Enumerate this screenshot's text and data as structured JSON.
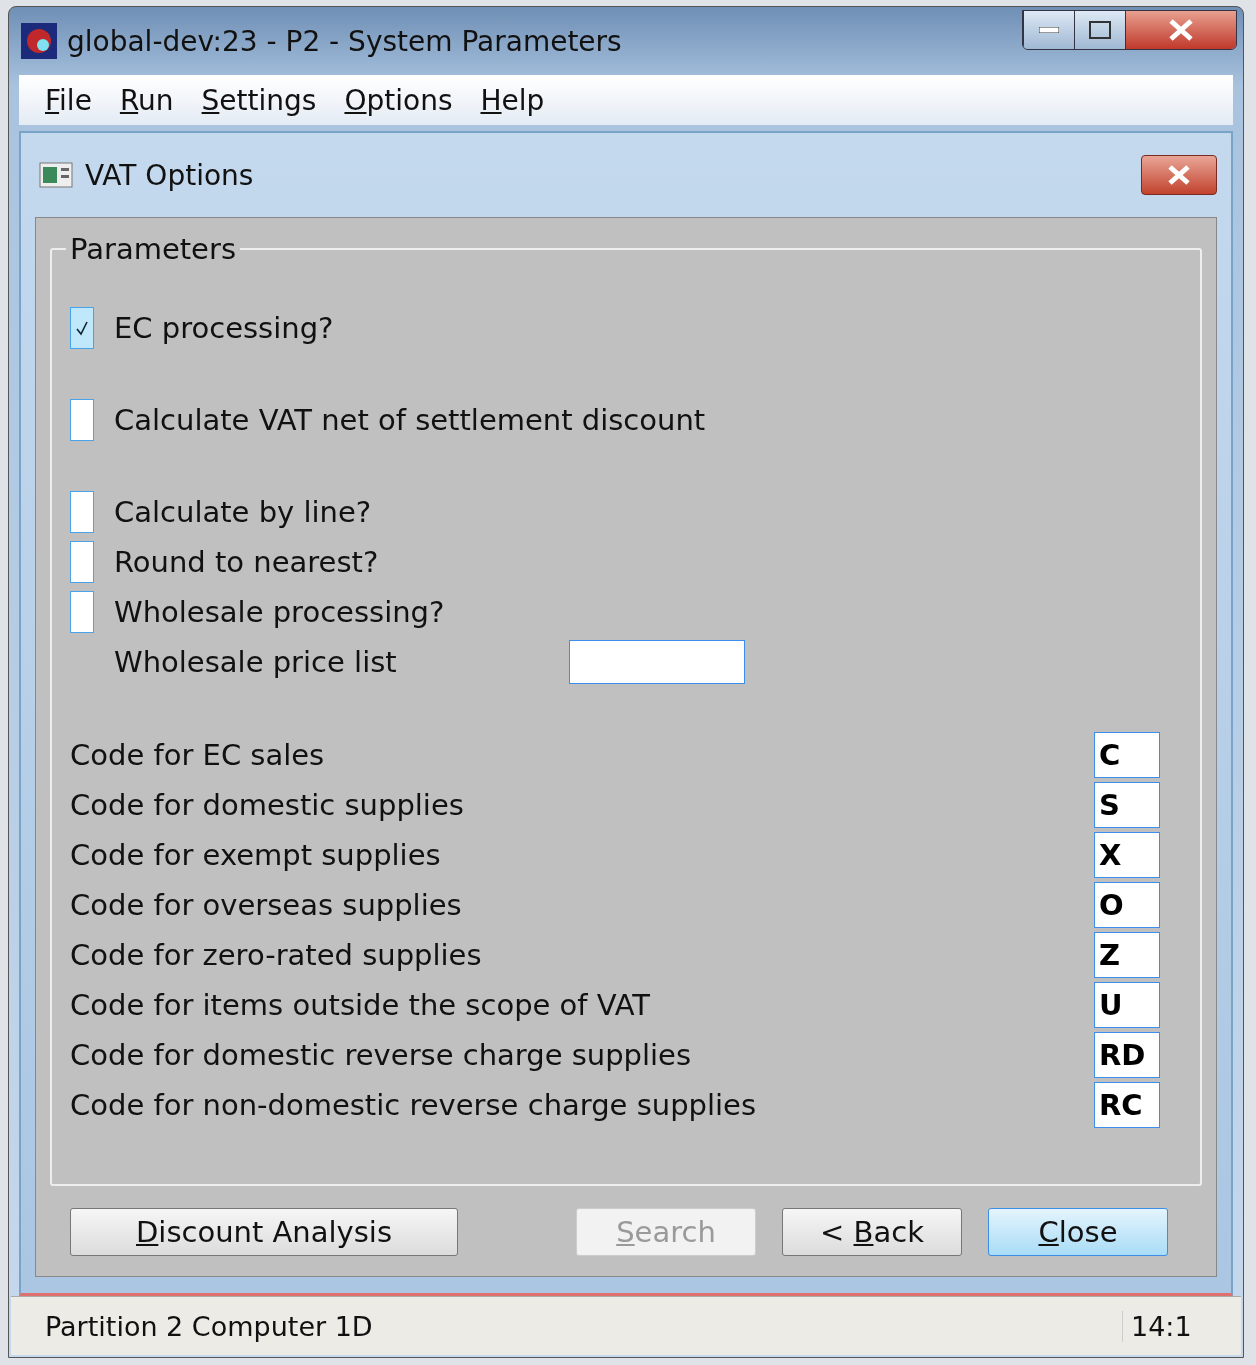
{
  "window": {
    "title": "global-dev:23 - P2 - System Parameters"
  },
  "menu": [
    {
      "key": "F",
      "rest": "ile"
    },
    {
      "key": "R",
      "rest": "un"
    },
    {
      "key": "S",
      "rest": "ettings"
    },
    {
      "key": "O",
      "rest": "ptions"
    },
    {
      "key": "H",
      "rest": "elp"
    }
  ],
  "dialog": {
    "title": "VAT Options",
    "parameters": {
      "legend": "Parameters",
      "groups": [
        [
          {
            "kind": "checkbox",
            "label": "EC processing?",
            "checked": true
          }
        ],
        [
          {
            "kind": "checkbox",
            "label": "Calculate VAT net of settlement discount",
            "checked": false
          }
        ],
        [
          {
            "kind": "checkbox",
            "label": "Calculate by line?",
            "checked": false
          },
          {
            "kind": "checkbox",
            "label": "Round to nearest?",
            "checked": false
          },
          {
            "kind": "checkbox",
            "label": "Wholesale processing?",
            "checked": false
          },
          {
            "kind": "field",
            "label": "Wholesale price list"
          }
        ]
      ],
      "codes": [
        {
          "label": "Code for EC sales",
          "value": "C"
        },
        {
          "label": "Code for domestic supplies",
          "value": "S"
        },
        {
          "label": "Code for exempt supplies",
          "value": "X"
        },
        {
          "label": "Code for overseas supplies",
          "value": "O"
        },
        {
          "label": "Code for zero-rated supplies",
          "value": "Z"
        },
        {
          "label": "Code for items outside the scope of VAT",
          "value": "U"
        },
        {
          "label": "Code for domestic reverse charge supplies",
          "value": "RD"
        },
        {
          "label": "Code for non-domestic reverse charge supplies",
          "value": "RC"
        }
      ]
    },
    "buttons": [
      {
        "key": "D",
        "rest": "iscount Analysis",
        "disabled": false,
        "default": false
      },
      {
        "key": "S",
        "rest": "earch",
        "disabled": true,
        "default": false
      },
      {
        "prefix": "< ",
        "key": "B",
        "rest": "ack",
        "disabled": false,
        "default": false
      },
      {
        "key": "C",
        "rest": "lose",
        "disabled": false,
        "default": true
      }
    ]
  },
  "status_bar": {
    "message": "Partition 2 Computer 1D",
    "time": "14:1"
  }
}
